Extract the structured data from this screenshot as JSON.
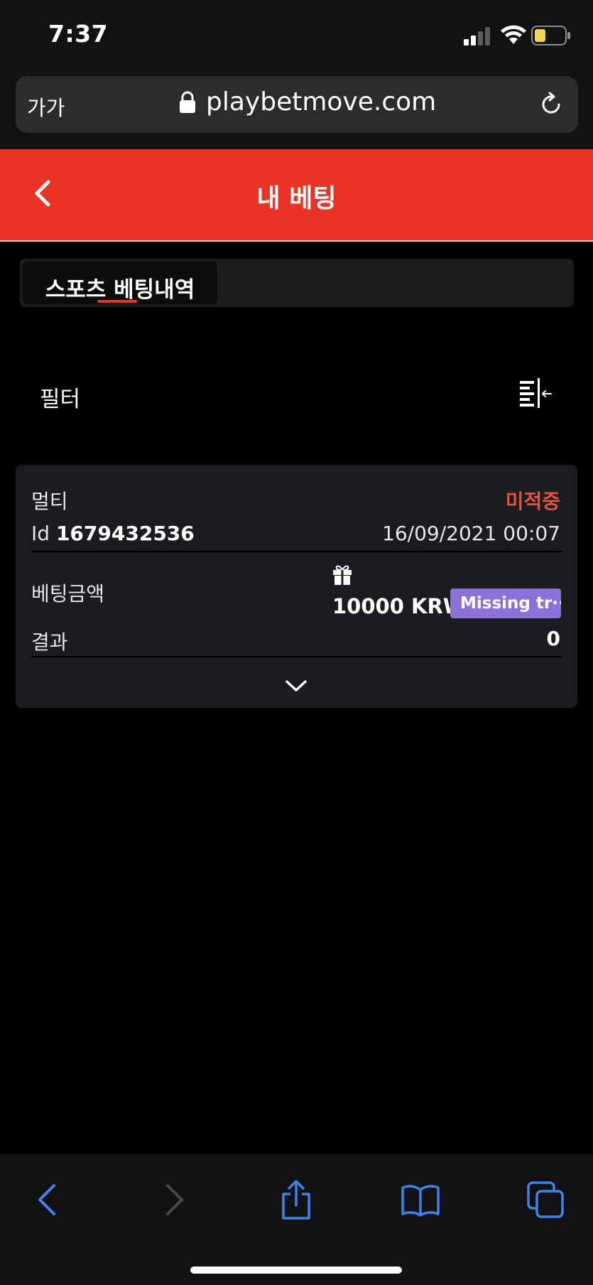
{
  "status_bar": {
    "time": "7:37",
    "battery_color": "#f2d64b"
  },
  "browser": {
    "text_size_button": "가가",
    "url": "playbetmove.com"
  },
  "header": {
    "title": "내 베팅",
    "background_color": "#ea3324"
  },
  "tabs": [
    {
      "label": "스포츠 베팅내역",
      "active": true
    }
  ],
  "filter": {
    "label": "필터"
  },
  "bets": [
    {
      "type": "멀티",
      "status": "미적중",
      "status_color": "#e0543e",
      "id_label": "Id",
      "id": "1679432536",
      "date": "16/09/2021 00:07",
      "stake_label": "베팅금액",
      "stake": "10000 KRW",
      "bonus_badge": "Missing tr···",
      "bonus_badge_color": "#8a72d8",
      "result_label": "결과",
      "result": "0"
    }
  ],
  "icons": {
    "back": "chevron-left-icon",
    "filter": "filter-icon",
    "gift": "gift-icon",
    "expand": "chevron-down-icon",
    "lock": "lock-icon",
    "reload": "reload-icon"
  },
  "accent_color": "#3d82f0"
}
